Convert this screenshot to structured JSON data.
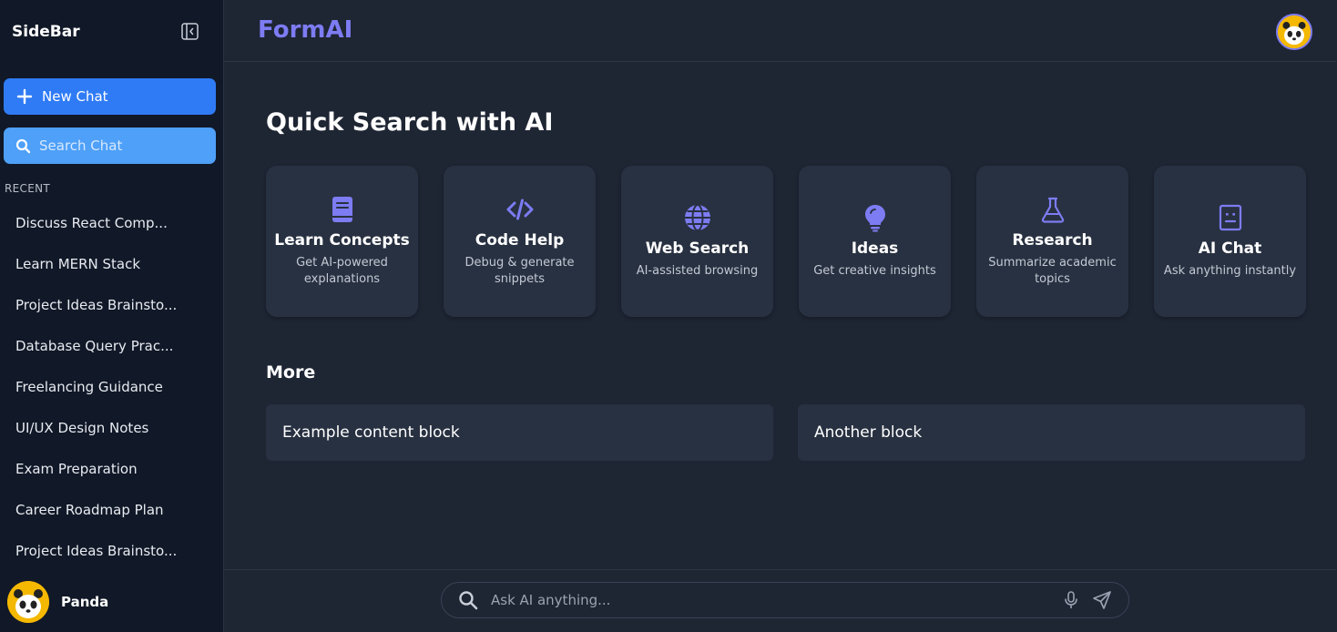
{
  "sidebar": {
    "title": "SideBar",
    "new_chat_label": "New Chat",
    "search_placeholder": "Search Chat",
    "recent_label": "RECENT",
    "recent_items": [
      "Discuss React Comp...",
      "Learn MERN Stack",
      "Project Ideas Brainsto...",
      "Database Query Prac...",
      "Freelancing Guidance",
      "UI/UX Design Notes",
      "Exam Preparation",
      "Career Roadmap Plan",
      "Project Ideas Brainsto..."
    ],
    "user_name": "Panda"
  },
  "header": {
    "brand": "FormAI"
  },
  "main": {
    "heading": "Quick Search with AI",
    "cards": [
      {
        "title": "Learn Concepts",
        "desc": "Get AI-powered explanations",
        "icon": "book-icon"
      },
      {
        "title": "Code Help",
        "desc": "Debug & generate snippets",
        "icon": "code-icon"
      },
      {
        "title": "Web Search",
        "desc": "AI-assisted browsing",
        "icon": "globe-icon"
      },
      {
        "title": "Ideas",
        "desc": "Get creative insights",
        "icon": "lightbulb-icon"
      },
      {
        "title": "Research",
        "desc": "Summarize academic topics",
        "icon": "flask-icon"
      },
      {
        "title": "AI Chat",
        "desc": "Ask anything instantly",
        "icon": "robot-icon"
      }
    ],
    "more_heading": "More",
    "blocks": [
      "Example content block",
      "Another block"
    ]
  },
  "ask_bar": {
    "placeholder": "Ask AI anything..."
  },
  "colors": {
    "accent": "#7d7cf3",
    "primary_button": "#2f7bf5",
    "search_button": "#4ea0f8",
    "sidebar_bg": "#111827",
    "main_bg": "#1e2533",
    "card_bg": "#283141"
  }
}
